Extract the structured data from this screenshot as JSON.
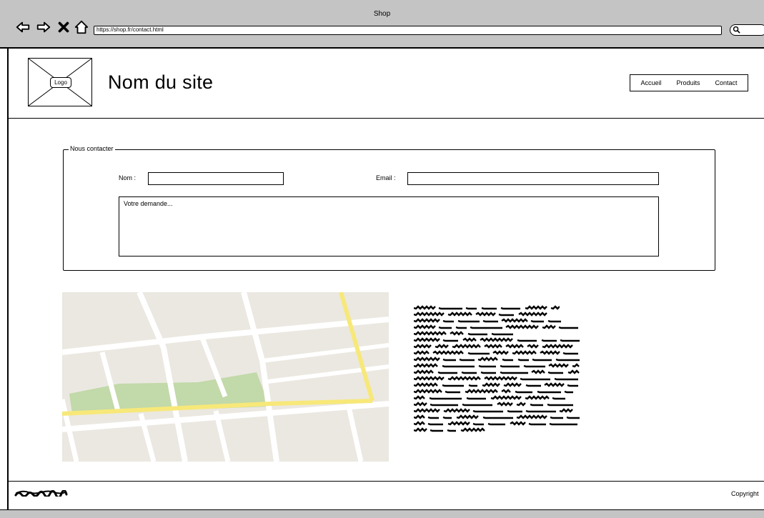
{
  "browser": {
    "window_title": "Shop",
    "url": "https://shop.fr/contact.html",
    "back_icon": "arrow-left-icon",
    "forward_icon": "arrow-right-icon",
    "stop_icon": "close-icon",
    "home_icon": "home-icon",
    "search_icon": "search-icon"
  },
  "header": {
    "logo_label": "Logo",
    "site_name": "Nom du site",
    "menu": [
      {
        "label": "Accueil"
      },
      {
        "label": "Produits"
      },
      {
        "label": "Contact"
      }
    ]
  },
  "contact": {
    "legend": "Nous contacter",
    "name_label": "Nom :",
    "name_value": "",
    "email_label": "Email :",
    "email_value": "",
    "request_placeholder": "Votre demande..."
  },
  "map": {
    "colors": {
      "land": "#ebe8e1",
      "road": "#ffffff",
      "main_road": "#f7e879",
      "park": "#c2d9a9"
    }
  },
  "footer": {
    "copyright": "Copyright"
  }
}
